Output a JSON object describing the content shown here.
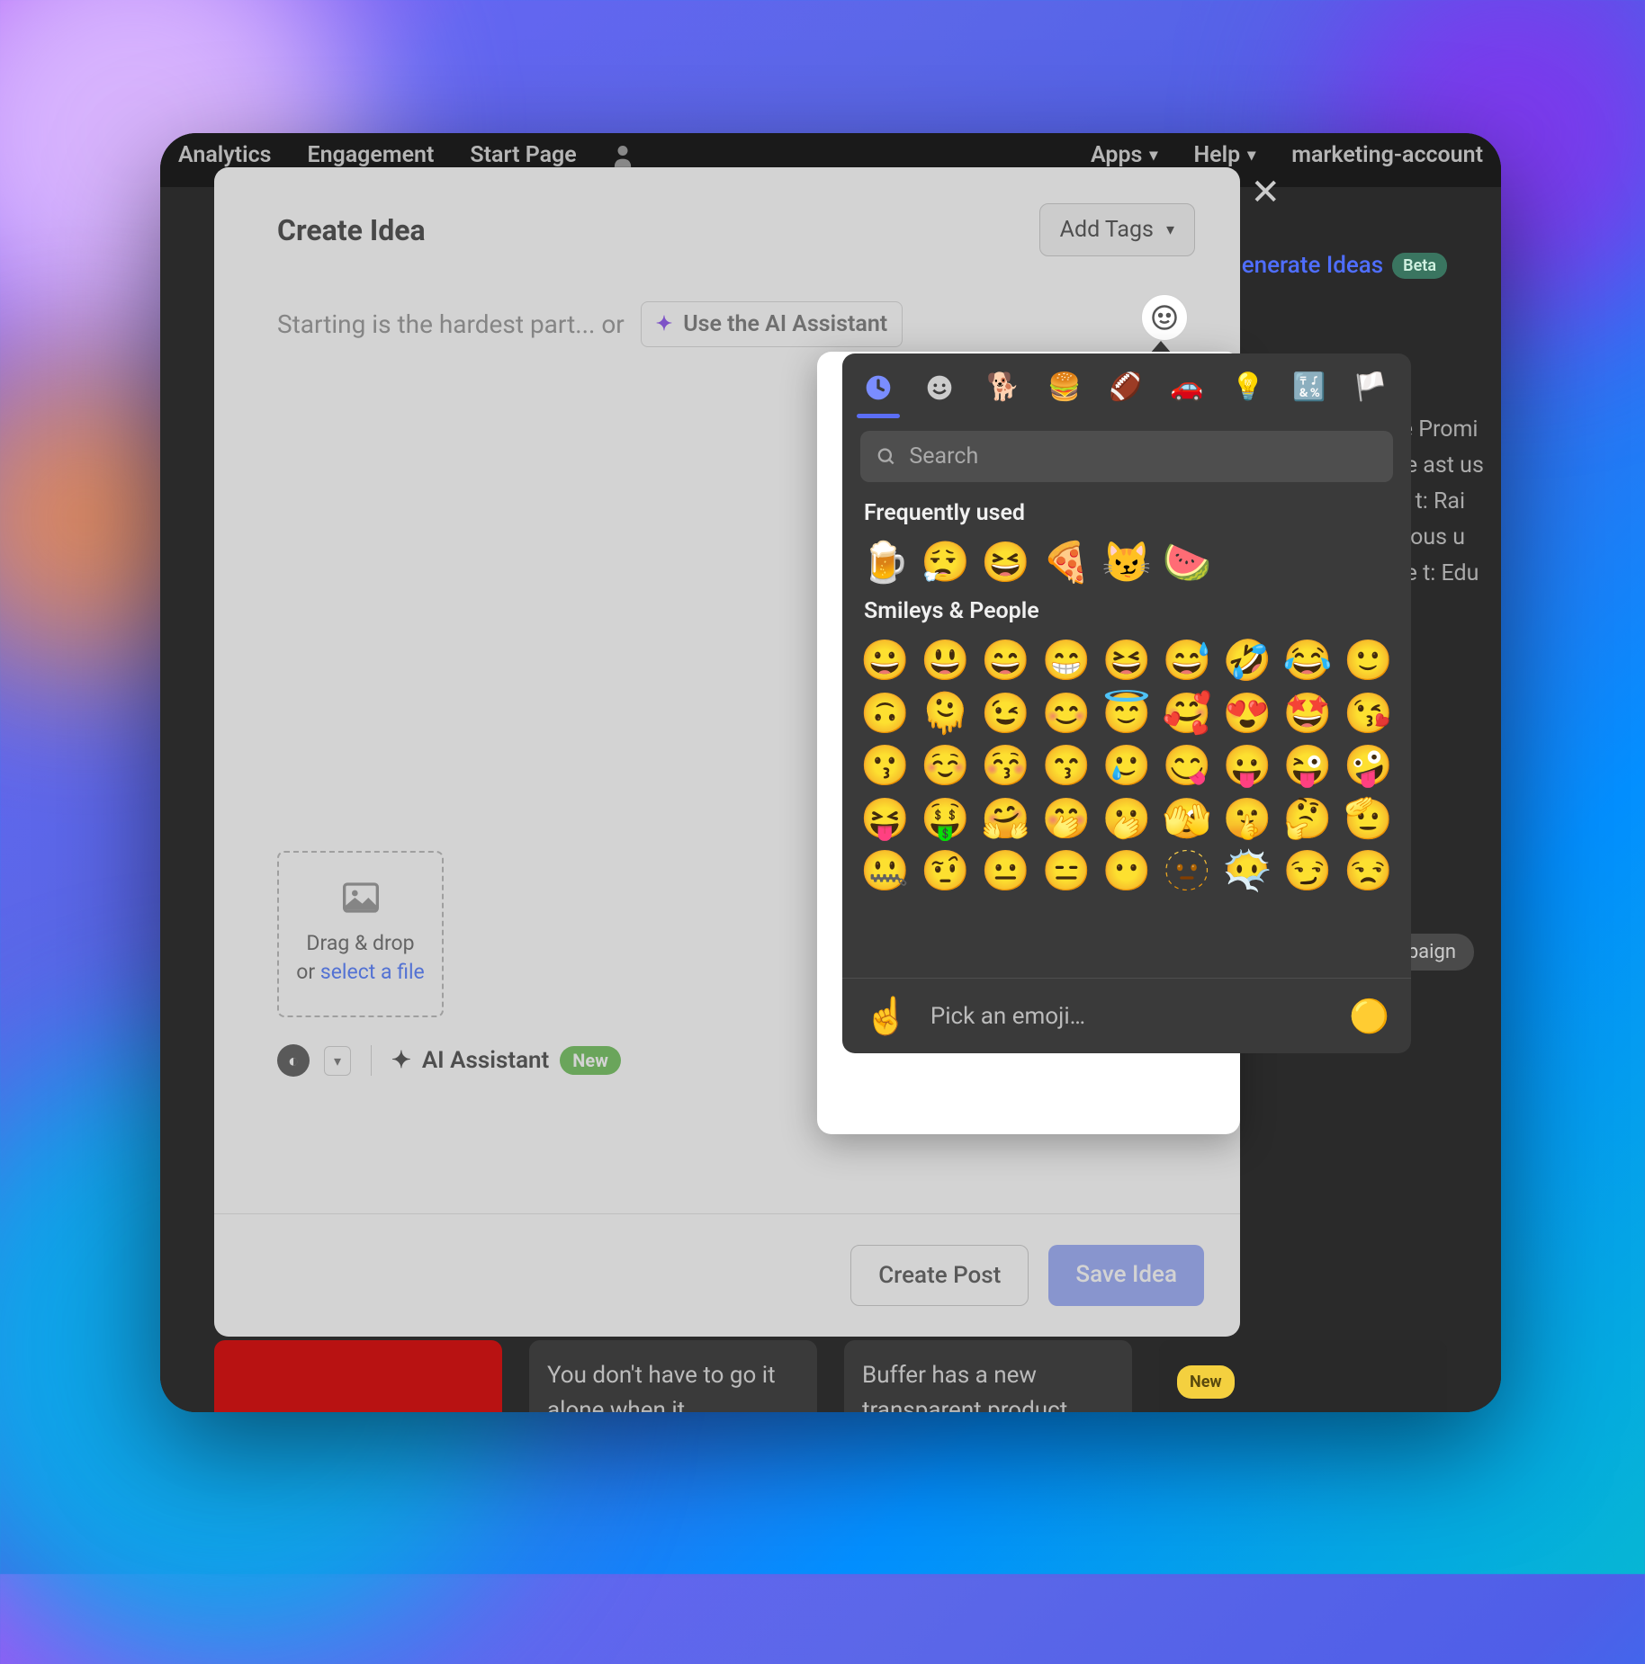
{
  "nav": {
    "items": [
      "Analytics",
      "Engagement",
      "Start Page",
      "",
      "Apps",
      "Help"
    ],
    "account": "marketing-account"
  },
  "background": {
    "generate": "Generate Ideas",
    "beta": "Beta",
    "campaign": "mpaign",
    "new_badge": "New",
    "snippets": [
      "You don't have to go it alone when it",
      "Buffer has a new transparent product"
    ],
    "side_text": "pfake Promi nalitie ast us ake s t: Rai ness ous u ake te t: Edu litera"
  },
  "modal": {
    "title": "Create Idea",
    "add_tags": "Add Tags",
    "placeholder": "Starting is the hardest part... or",
    "use_ai": "Use the AI Assistant",
    "dropzone": {
      "line1": "Drag & drop",
      "line2_prefix": "or ",
      "link": "select a file"
    },
    "ai_row": "AI Assistant",
    "new": "New",
    "create_post": "Create Post",
    "save_idea": "Save Idea"
  },
  "emoji_picker": {
    "search_placeholder": "Search",
    "frequently_used_label": "Frequently used",
    "frequently_used": [
      "🍺",
      "😮‍💨",
      "😆",
      "🍕",
      "😼",
      "🍉"
    ],
    "smileys_label": "Smileys & People",
    "smileys": [
      "😀",
      "😃",
      "😄",
      "😁",
      "😆",
      "😅",
      "🤣",
      "😂",
      "🙂",
      "🙃",
      "🫠",
      "😉",
      "😊",
      "😇",
      "🥰",
      "😍",
      "🤩",
      "😘",
      "😗",
      "☺️",
      "😚",
      "😙",
      "🥲",
      "😋",
      "😛",
      "😜",
      "🤪",
      "😝",
      "🤑",
      "🤗",
      "🤭",
      "🫢",
      "🫣",
      "🤫",
      "🤔",
      "🫡",
      "🤐",
      "🤨",
      "😐",
      "😑",
      "😶",
      "🫥",
      "😶‍🌫️",
      "😏",
      "😒"
    ],
    "footer_preview": "☝️",
    "footer_text": "Pick an emoji…",
    "skin_tone": "🟡"
  }
}
